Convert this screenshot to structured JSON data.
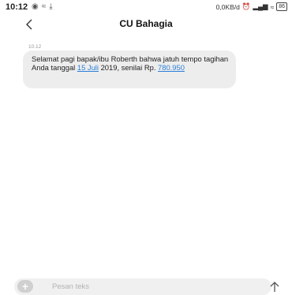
{
  "status_bar": {
    "time": "10:12",
    "left_icons": [
      "notification-icon",
      "wifi-off-icon",
      "download-icon"
    ],
    "network_speed": "0,0KB/d",
    "battery": "86"
  },
  "header": {
    "title": "CU Bahagia"
  },
  "conversation": {
    "timestamp": "10.12",
    "message": {
      "text_before_date": "Selamat pagi bapak/ibu Roberth bahwa jatuh tempo tagihan Anda tanggal ",
      "date_link": "15 Juli",
      "text_middle": " 2019, senilai Rp. ",
      "amount_link": "780.950"
    }
  },
  "composer": {
    "placeholder": "Pesan teks"
  },
  "colors": {
    "link": "#2c7fd8",
    "bubble": "#ededed"
  }
}
